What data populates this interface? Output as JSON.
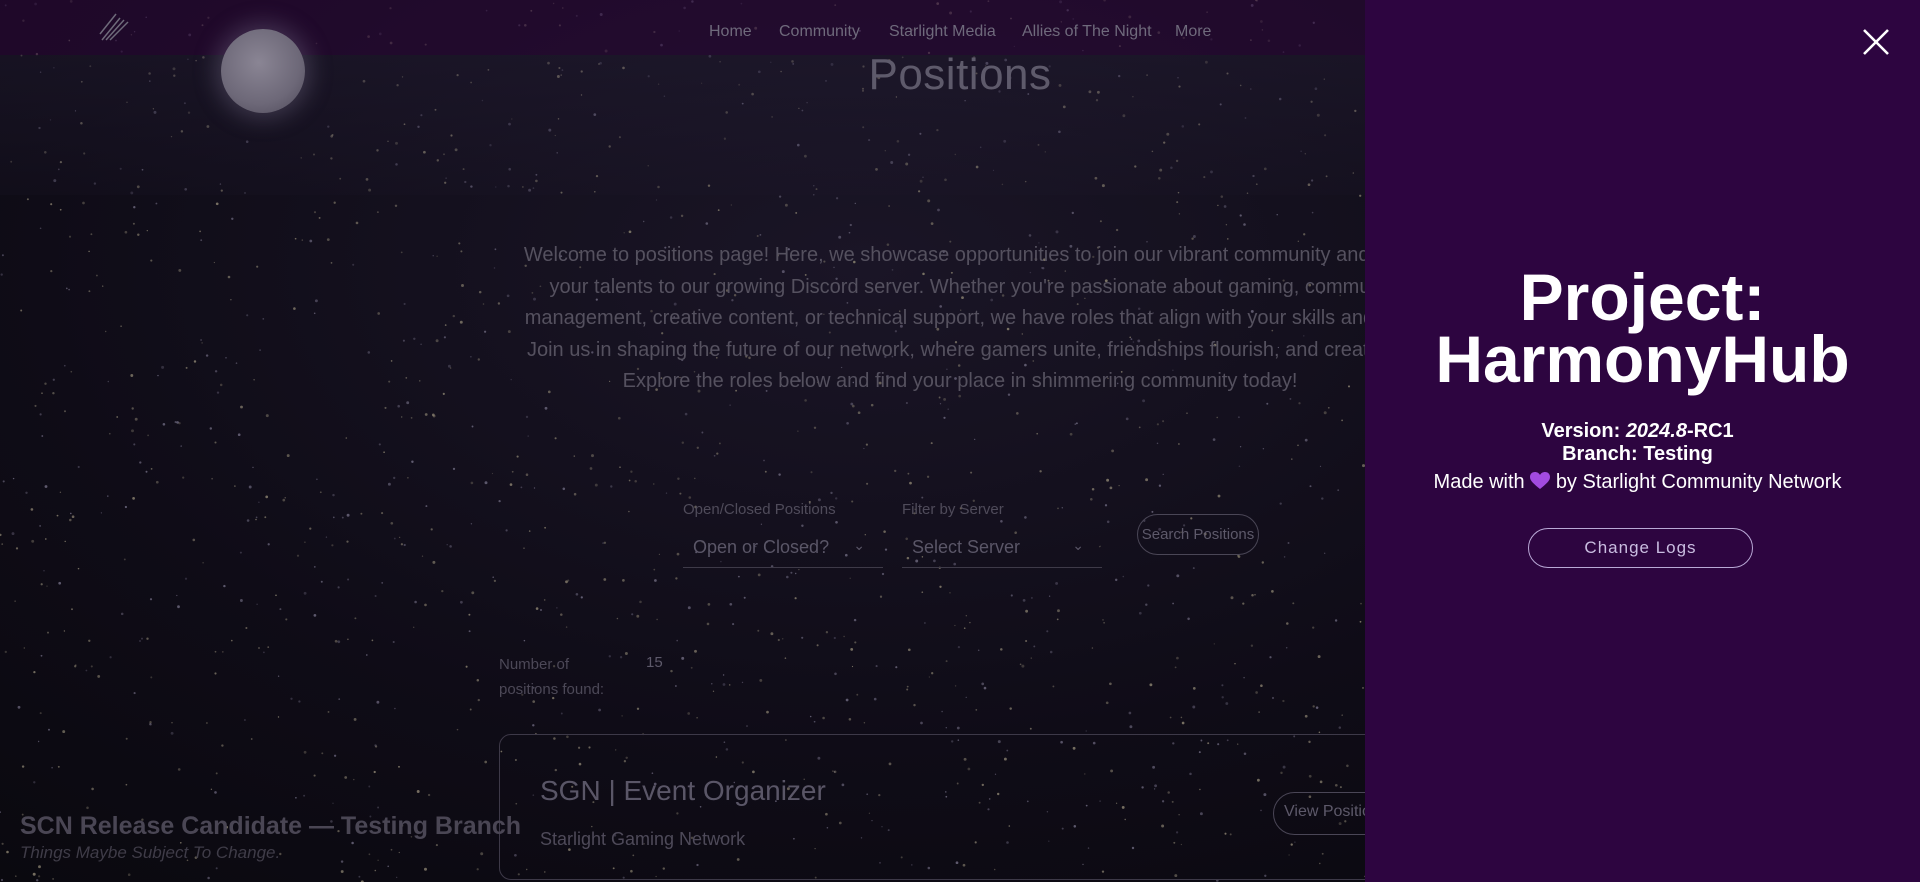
{
  "nav": {
    "items": [
      "Home",
      "Community",
      "Starlight Media",
      "Allies of The Night",
      "More"
    ]
  },
  "page": {
    "title": "Positions",
    "intro_lines": [
      "Welcome to positions page! Here, we showcase opportunities to join our vibrant community and co",
      "your talents to our growing Discord server. Whether you're passionate about gaming, commu",
      "management, creative content, or technical support, we have roles that align with your skills and in",
      "Join us in shaping the future of our network, where gamers unite, friendships flourish, and creativit",
      "Explore the roles below and find your place in shimmering community today!"
    ]
  },
  "filters": {
    "status_label": "Open/Closed Positions",
    "status_value": "Open or Closed?",
    "server_label": "Filter by Server",
    "server_value": "Select Server",
    "search_label": "Search Positions"
  },
  "results": {
    "count_label": "Number of positions found:",
    "count_value": "15"
  },
  "card": {
    "title": "SGN | Event Organizer",
    "subtitle": "Starlight Gaming Network",
    "button": "View Positio"
  },
  "banner": {
    "title": "SCN Release Candidate — Testing Branch",
    "subtitle": "Things Maybe Subject To Change."
  },
  "panel": {
    "title_line1": "Project:",
    "title_line2": "HarmonyHub",
    "version_label": "Version: ",
    "version_italic": "2024.8",
    "version_suffix": "-RC1",
    "branch": "Branch: Testing",
    "made_prefix": "Made with",
    "made_suffix": "by Starlight Community Network",
    "changelog_button": "Change Logs"
  },
  "icons": {
    "close": "close-icon",
    "heart": "purple-heart-icon",
    "chevron": "chevron-down-icon"
  },
  "colors": {
    "panel_bg": "#2d0540",
    "heart": "#a24be0",
    "panel_text": "#ffffff"
  }
}
